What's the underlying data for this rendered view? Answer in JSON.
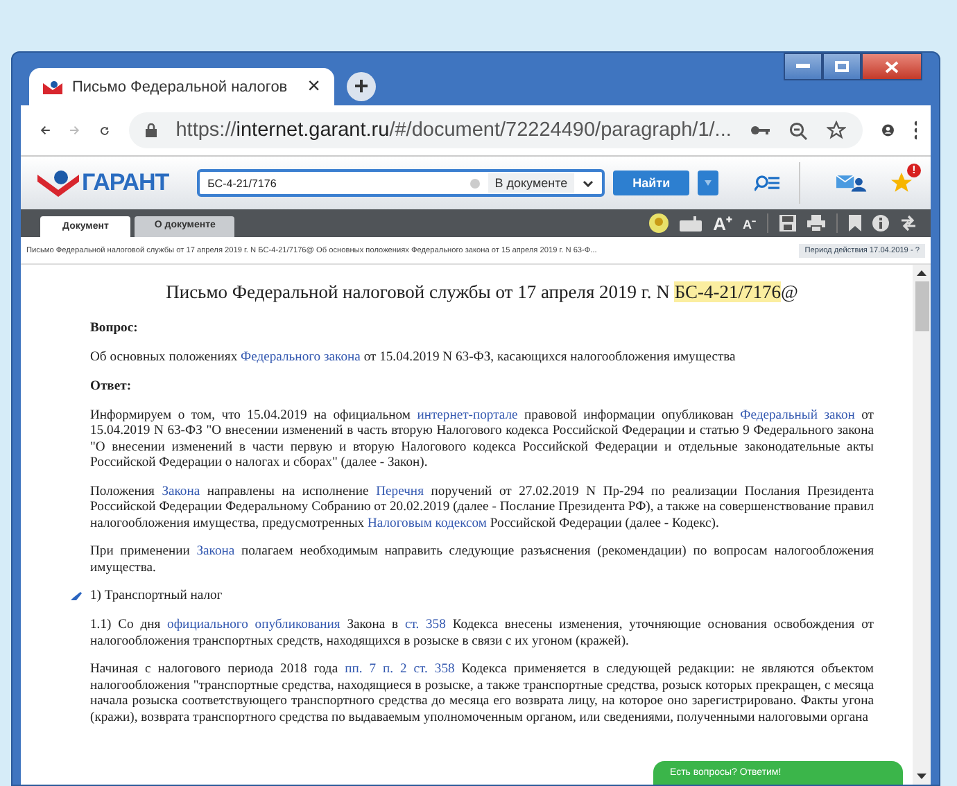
{
  "browser": {
    "tab": {
      "title": "Письмо Федеральной налогов",
      "close": "×"
    },
    "new_tab": "+",
    "url": "https://**internet.garant.ru**/#/document/72224490/paragraph/1/..."
  },
  "toolbar": {
    "logo": "ГАРАНТ",
    "search": {
      "value": "БС-4-21/7176"
    },
    "scope": "В документе",
    "find_button": "Найти",
    "favorites_badge": "!"
  },
  "doc_tabs": [
    {
      "label": "Документ",
      "selected": true
    },
    {
      "label": "О документе",
      "selected": false
    }
  ],
  "doc_tools": {
    "font_larger": "A⁺",
    "font_smaller": "A⁻"
  },
  "breadcrumb": "Письмо Федеральной налоговой службы от 17 апреля 2019 г. N БС-4-21/7176@ Об основных положениях Федерального закона от 15 апреля 2019 г. N 63-Ф...",
  "validity": "Период действия 17.04.2019 - ?",
  "document": {
    "title": [
      {
        "kind": "text",
        "text": "Письмо Федеральной налоговой службы от 17 апреля 2019 г. N "
      },
      {
        "kind": "highlight",
        "text": "БС-4-21/7176"
      },
      {
        "kind": "text",
        "text": "@"
      }
    ],
    "blocks": [
      {
        "kind": "heading",
        "parts": [
          {
            "kind": "text",
            "text": "Вопрос:"
          }
        ]
      },
      {
        "kind": "para",
        "parts": [
          {
            "kind": "text",
            "text": "Об основных положениях "
          },
          {
            "kind": "link",
            "text": "Федерального закона"
          },
          {
            "kind": "text",
            "text": " от 15.04.2019 N 63-ФЗ, касающихся налогообложения имущества"
          }
        ]
      },
      {
        "kind": "heading",
        "parts": [
          {
            "kind": "text",
            "text": "Ответ:"
          }
        ]
      },
      {
        "kind": "para",
        "parts": [
          {
            "kind": "text",
            "text": "Информируем о том, что 15.04.2019 на официальном "
          },
          {
            "kind": "link",
            "text": "интернет-портале"
          },
          {
            "kind": "text",
            "text": " правовой информации опубликован "
          },
          {
            "kind": "link",
            "text": "Федеральный закон"
          },
          {
            "kind": "text",
            "text": " от 15.04.2019 N 63-ФЗ \"О внесении изменений в часть вторую Налогового кодекса Российской Федерации и статью 9 Федерального закона \"О внесении изменений в части первую и вторую Налогового кодекса Российской Федерации и отдельные законодательные акты Российской Федерации о налогах и сборах\" (далее - Закон)."
          }
        ]
      },
      {
        "kind": "para",
        "parts": [
          {
            "kind": "text",
            "text": "Положения "
          },
          {
            "kind": "link",
            "text": "Закона"
          },
          {
            "kind": "text",
            "text": " направлены на исполнение "
          },
          {
            "kind": "link",
            "text": "Перечня"
          },
          {
            "kind": "text",
            "text": " поручений от 27.02.2019 N Пр-294 по реализации Послания Президента Российской Федерации Федеральному Собранию от 20.02.2019 (далее - Послание Президента РФ), а также на совершенствование правил налогообложения имущества, предусмотренных "
          },
          {
            "kind": "link",
            "text": "Налоговым кодексом"
          },
          {
            "kind": "text",
            "text": " Российской Федерации (далее - Кодекс)."
          }
        ]
      },
      {
        "kind": "para",
        "parts": [
          {
            "kind": "text",
            "text": "При применении "
          },
          {
            "kind": "link",
            "text": "Закона"
          },
          {
            "kind": "text",
            "text": " полагаем необходимым направить следующие разъяснения (рекомендации) по вопросам налогообложения имущества."
          }
        ]
      },
      {
        "kind": "item",
        "parts": [
          {
            "kind": "text",
            "text": "1) Транспортный налог"
          }
        ]
      },
      {
        "kind": "para",
        "parts": [
          {
            "kind": "text",
            "text": "1.1) Со дня "
          },
          {
            "kind": "link",
            "text": "официального опубликования"
          },
          {
            "kind": "text",
            "text": " Закона в "
          },
          {
            "kind": "link",
            "text": "ст. 358"
          },
          {
            "kind": "text",
            "text": " Кодекса внесены изменения, уточняющие основания освобождения от налогообложения транспортных средств, находящихся в розыске в связи с их угоном (кражей)."
          }
        ]
      },
      {
        "kind": "para",
        "parts": [
          {
            "kind": "text",
            "text": "Начиная с налогового периода 2018 года "
          },
          {
            "kind": "link",
            "text": "пп. 7 п. 2 ст. 358"
          },
          {
            "kind": "text",
            "text": " Кодекса применяется в следующей редакции: не являются объектом налогообложения \"транспортные средства, находящиеся в розыске, а также транспортные средства, розыск которых прекращен, с месяца начала розыска соответствующего транспортного средства до месяца его возврата лицу, на которое оно зарегистрировано. Факты угона (кражи), возврата транспортного средства по выдаваемым уполномоченным органом, или сведениями, полученными налоговыми органа"
          }
        ]
      }
    ]
  },
  "chat": "Есть вопросы? Ответим!"
}
